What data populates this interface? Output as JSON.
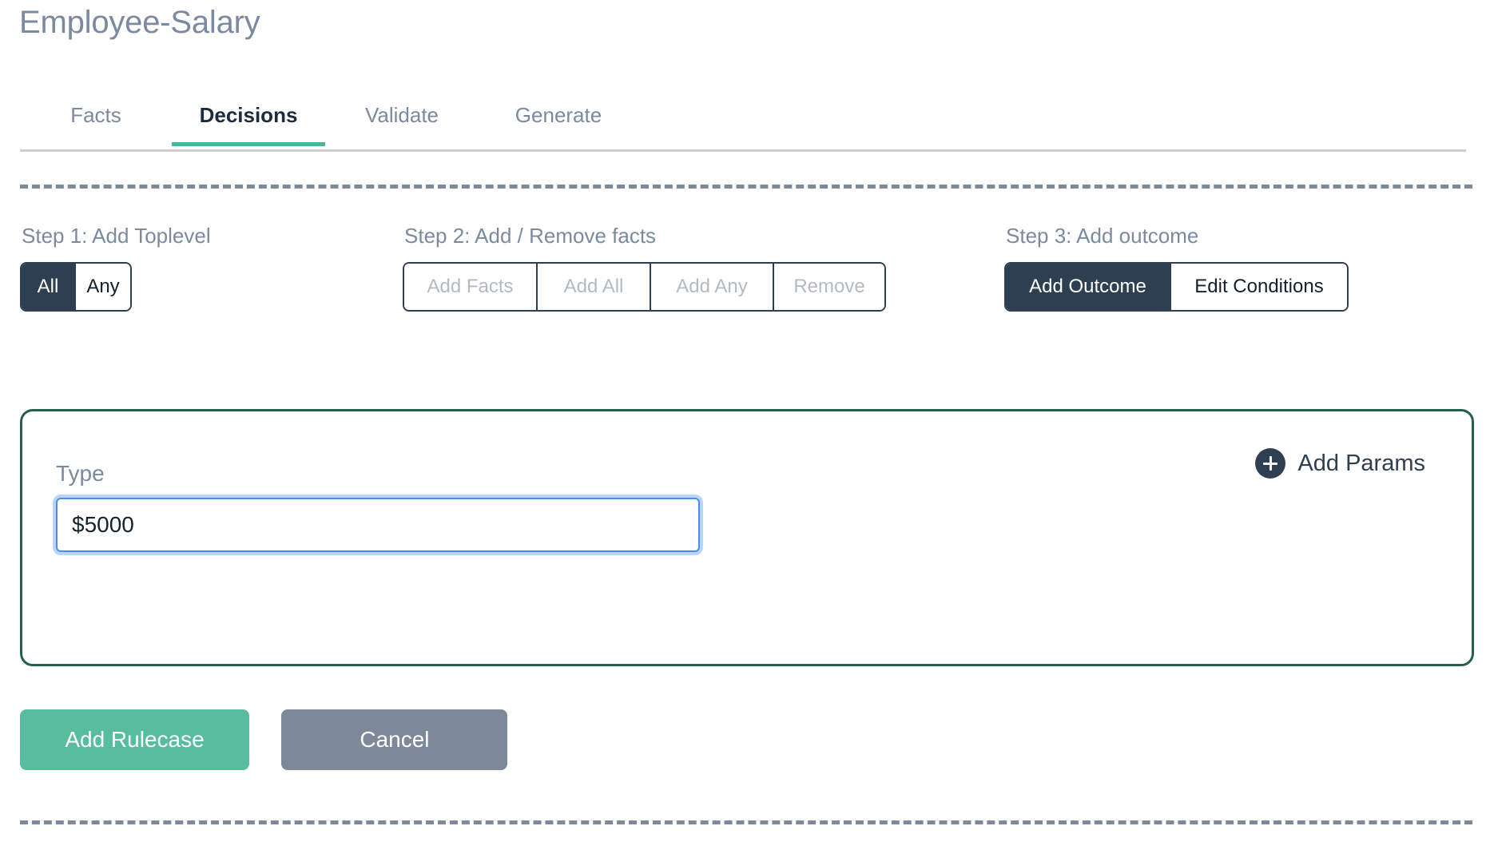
{
  "header": {
    "title": "Employee-Salary"
  },
  "tabs": [
    {
      "label": "Facts",
      "active": false
    },
    {
      "label": "Decisions",
      "active": true
    },
    {
      "label": "Validate",
      "active": false
    },
    {
      "label": "Generate",
      "active": false
    }
  ],
  "steps": {
    "step1": {
      "label": "Step 1: Add Toplevel",
      "options": [
        {
          "label": "All",
          "selected": true,
          "disabled": false
        },
        {
          "label": "Any",
          "selected": false,
          "disabled": false
        }
      ]
    },
    "step2": {
      "label": "Step 2: Add / Remove facts",
      "options": [
        {
          "label": "Add Facts",
          "selected": false,
          "disabled": true
        },
        {
          "label": "Add All",
          "selected": false,
          "disabled": true
        },
        {
          "label": "Add Any",
          "selected": false,
          "disabled": true
        },
        {
          "label": "Remove",
          "selected": false,
          "disabled": true
        }
      ]
    },
    "step3": {
      "label": "Step 3: Add outcome",
      "options": [
        {
          "label": "Add Outcome",
          "selected": true,
          "disabled": false
        },
        {
          "label": "Edit Conditions",
          "selected": false,
          "disabled": false
        }
      ]
    }
  },
  "card": {
    "add_params_label": "Add Params",
    "add_params_icon": "plus-circle-icon",
    "field": {
      "label": "Type",
      "value": "$5000",
      "placeholder": "",
      "focused": true
    }
  },
  "footer": {
    "submit_label": "Add Rulecase",
    "cancel_label": "Cancel"
  },
  "colors": {
    "accent_green": "#58bd9c",
    "tab_active_underline": "#4cb498",
    "dark_navy": "#2f3f52",
    "muted_text": "#7b8a9e",
    "card_border": "#26604c",
    "cancel_gray": "#7d8898",
    "focus_blue": "#4a90e2",
    "dashed_rule": "#7c8a9c"
  }
}
